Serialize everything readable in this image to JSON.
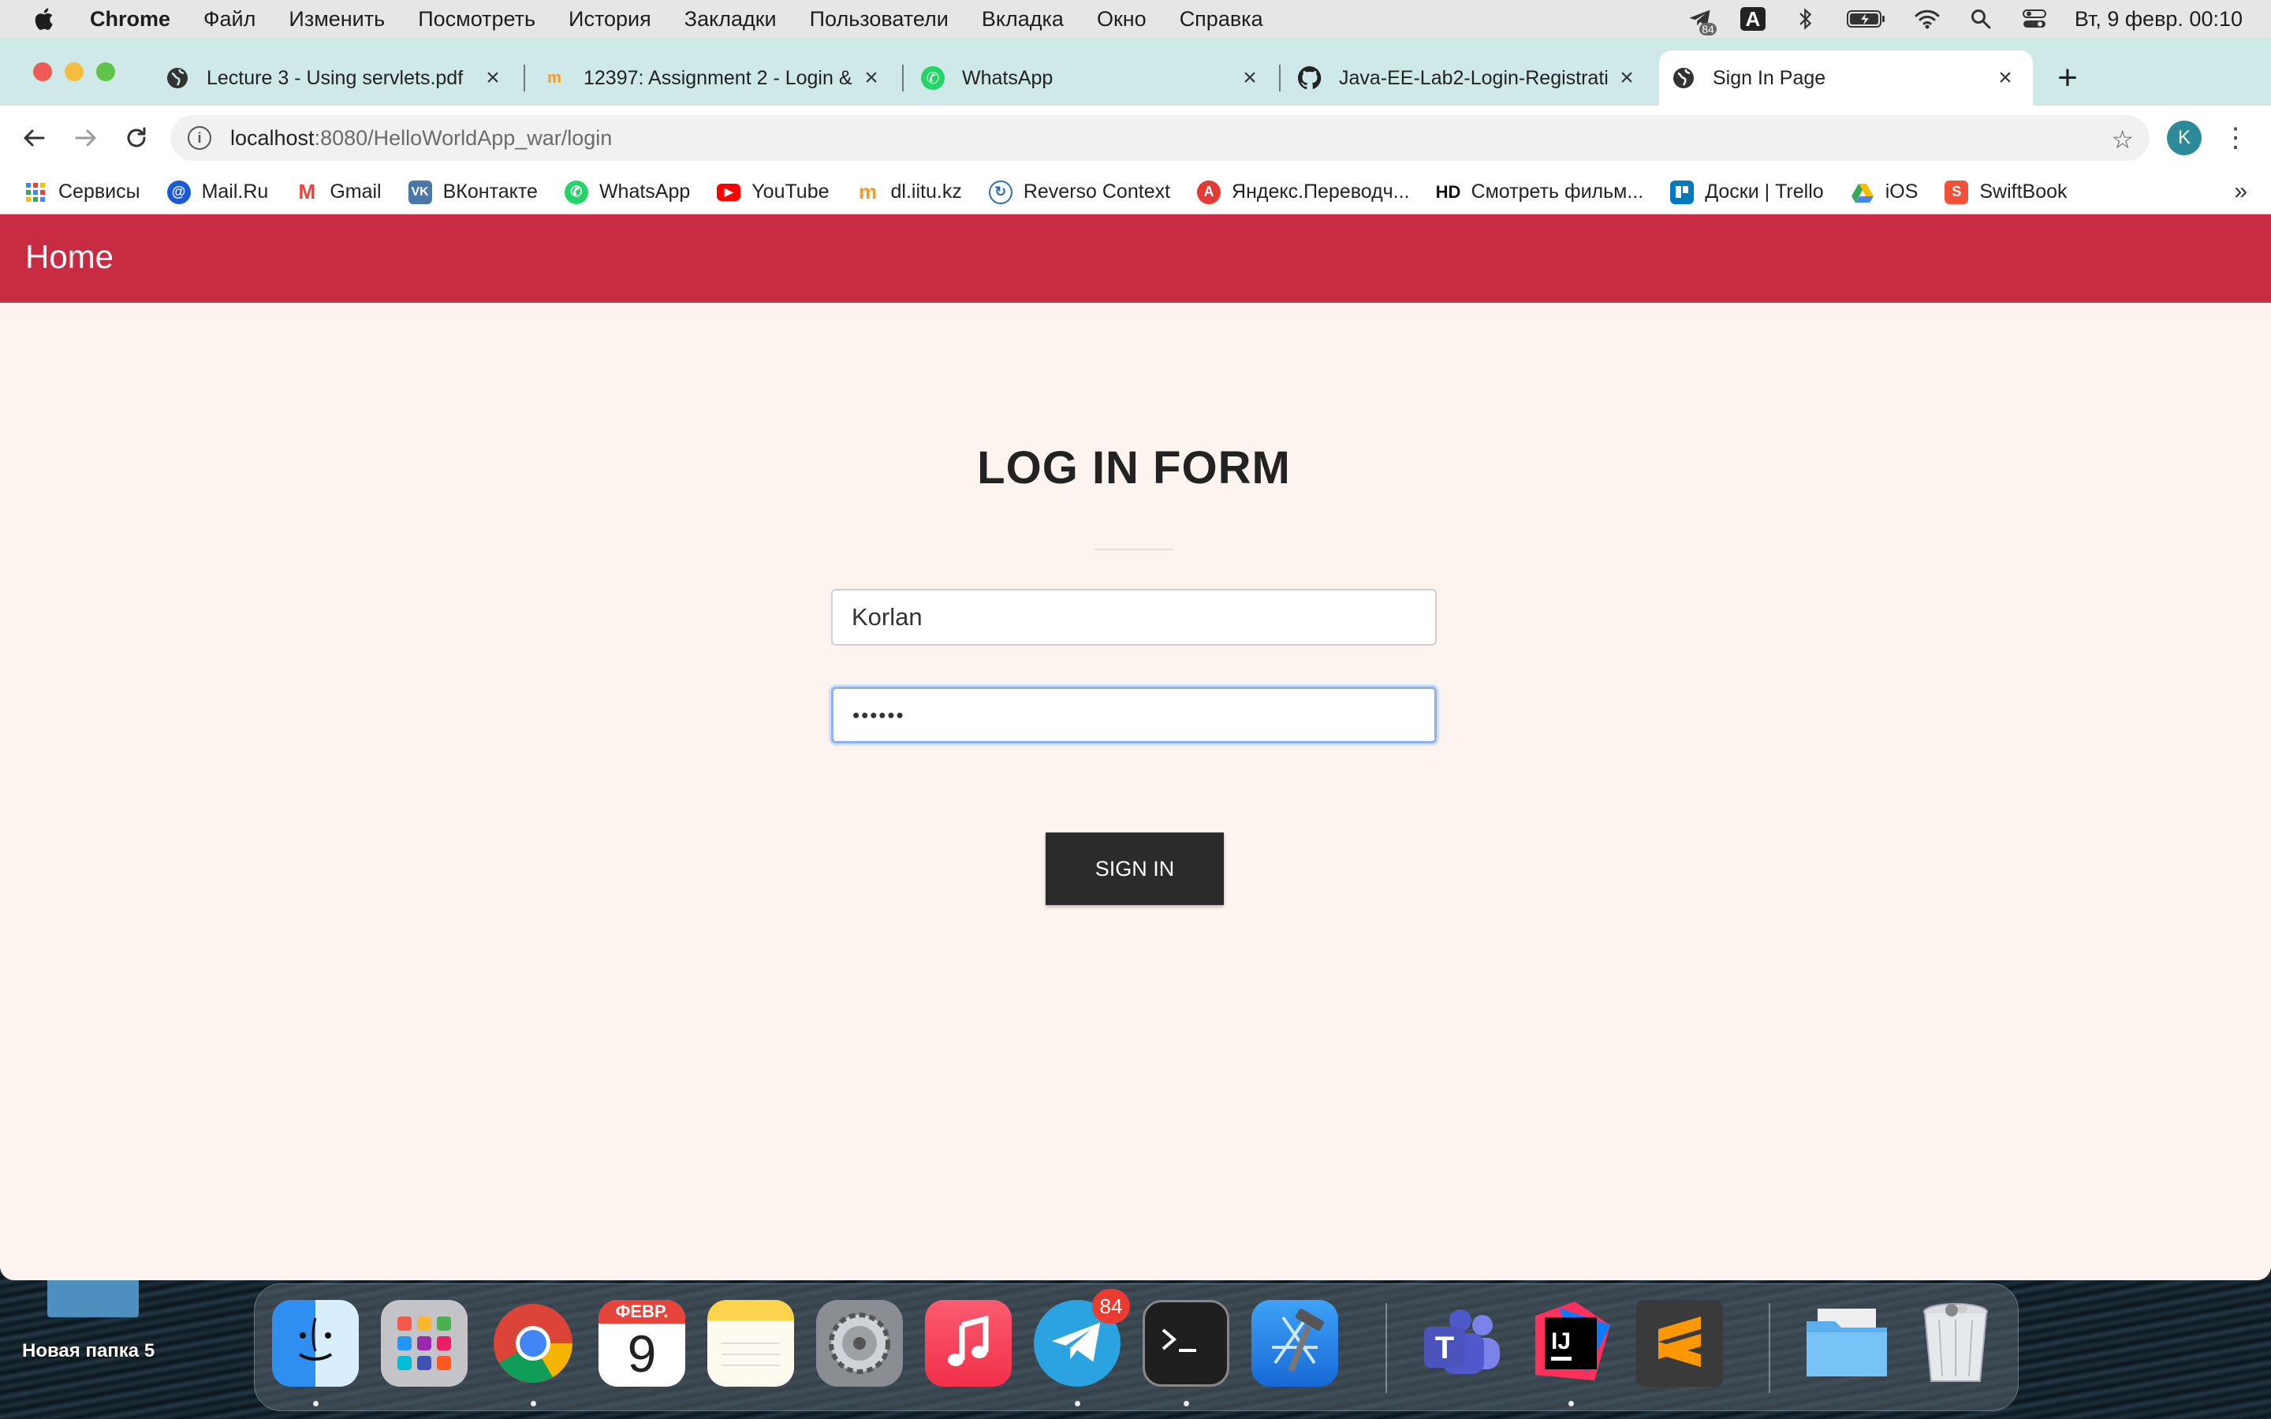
{
  "menubar": {
    "app_name": "Chrome",
    "items": [
      "Файл",
      "Изменить",
      "Посмотреть",
      "История",
      "Закладки",
      "Пользователи",
      "Вкладка",
      "Окно",
      "Справка"
    ],
    "telegram_count": "84",
    "input_source": "A",
    "clock": "Вт, 9 февр.  00:10"
  },
  "tabs": [
    {
      "title": "Lecture 3 - Using servlets.pdf",
      "icon": "globe-icon"
    },
    {
      "title": "12397: Assignment 2 - Login &",
      "icon": "moodle-icon"
    },
    {
      "title": "WhatsApp",
      "icon": "whatsapp-icon"
    },
    {
      "title": "Java-EE-Lab2-Login-Registrati",
      "icon": "github-icon"
    },
    {
      "title": "Sign In Page",
      "icon": "globe-icon",
      "active": true
    }
  ],
  "omnibox": {
    "host": "localhost",
    "path": ":8080/HelloWorldApp_war/login"
  },
  "profile_initial": "K",
  "bookmarks": [
    {
      "label": "Сервисы",
      "icon": "apps-grid-icon",
      "color": "#4285f4"
    },
    {
      "label": "Mail.Ru",
      "icon": "mailru-icon",
      "color": "#1a5ad8"
    },
    {
      "label": "Gmail",
      "icon": "gmail-icon",
      "color": "#ea4335"
    },
    {
      "label": "ВКонтакте",
      "icon": "vk-icon",
      "color": "#4a76a8"
    },
    {
      "label": "WhatsApp",
      "icon": "whatsapp-icon",
      "color": "#25d366"
    },
    {
      "label": "YouTube",
      "icon": "youtube-icon",
      "color": "#ff0000"
    },
    {
      "label": "dl.iitu.kz",
      "icon": "moodle-icon",
      "color": "#f79a1e"
    },
    {
      "label": "Reverso Context",
      "icon": "reverso-icon",
      "color": "#2a6fb8"
    },
    {
      "label": "Яндекс.Переводч...",
      "icon": "yandex-translate-icon",
      "color": "#e53935"
    },
    {
      "label": "Смотреть фильм...",
      "icon": "hd-icon",
      "color": "#111111"
    },
    {
      "label": "Доски | Trello",
      "icon": "trello-icon",
      "color": "#0079bf"
    },
    {
      "label": "iOS",
      "icon": "google-drive-icon",
      "color": "#34a853"
    },
    {
      "label": "SwiftBook",
      "icon": "swiftbook-icon",
      "color": "#f05138"
    }
  ],
  "bookmark_hd_text": "HD",
  "page": {
    "nav_home": "Home",
    "title": "LOG IN FORM",
    "username_value": "Korlan",
    "password_value": "••••••",
    "signin_label": "SIGN IN"
  },
  "colors": {
    "navbar": "#c82c43",
    "page_bg": "#fdf4ef",
    "button": "#2b2b2b",
    "tabstrip": "#cfe9e9"
  },
  "desktop": {
    "folder_label": "Новая папка 5"
  },
  "dock": {
    "calendar_month": "ФЕВР.",
    "calendar_day": "9",
    "telegram_badge": "84",
    "apps": [
      "finder-icon",
      "launchpad-icon",
      "chrome-icon",
      "calendar-icon",
      "notes-icon",
      "system-preferences-icon",
      "music-icon",
      "telegram-icon",
      "terminal-icon",
      "xcode-icon",
      "teams-icon",
      "intellij-icon",
      "sublime-icon",
      "folder-icon",
      "trash-icon"
    ]
  }
}
